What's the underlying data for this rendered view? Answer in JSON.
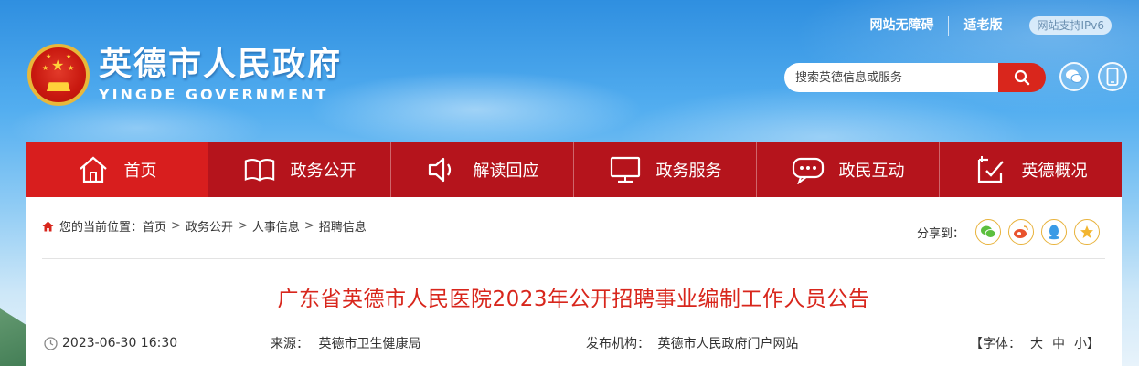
{
  "header": {
    "links": [
      "网站无障碍",
      "适老版"
    ],
    "ipv6": "网站支持IPv6",
    "logo_cn": "英德市人民政府",
    "logo_en": "YINGDE GOVERNMENT",
    "search_placeholder": "搜索英德信息或服务"
  },
  "nav": [
    {
      "label": "首页",
      "icon": "home-icon",
      "active": true
    },
    {
      "label": "政务公开",
      "icon": "book-icon",
      "active": false
    },
    {
      "label": "解读回应",
      "icon": "speaker-icon",
      "active": false
    },
    {
      "label": "政务服务",
      "icon": "monitor-icon",
      "active": false
    },
    {
      "label": "政民互动",
      "icon": "chat-bubble-icon",
      "active": false
    },
    {
      "label": "英德概况",
      "icon": "checklist-icon",
      "active": false
    }
  ],
  "breadcrumb": {
    "prefix": "您的当前位置：",
    "items": [
      "首页",
      "政务公开",
      "人事信息",
      "招聘信息"
    ]
  },
  "share": {
    "label": "分享到："
  },
  "article": {
    "title": "广东省英德市人民医院2023年公开招聘事业编制工作人员公告",
    "datetime": "2023-06-30 16:30",
    "source_label": "来源：",
    "source": "英德市卫生健康局",
    "publisher_label": "发布机构：",
    "publisher": "英德市人民政府门户网站",
    "font_label": "【字体：",
    "font_sizes": [
      "大",
      "中",
      "小】"
    ]
  },
  "colors": {
    "nav_bg": "#b5141c",
    "nav_active": "#d81e1e",
    "title_red": "#d8261c",
    "search_btn": "#d9261c"
  }
}
